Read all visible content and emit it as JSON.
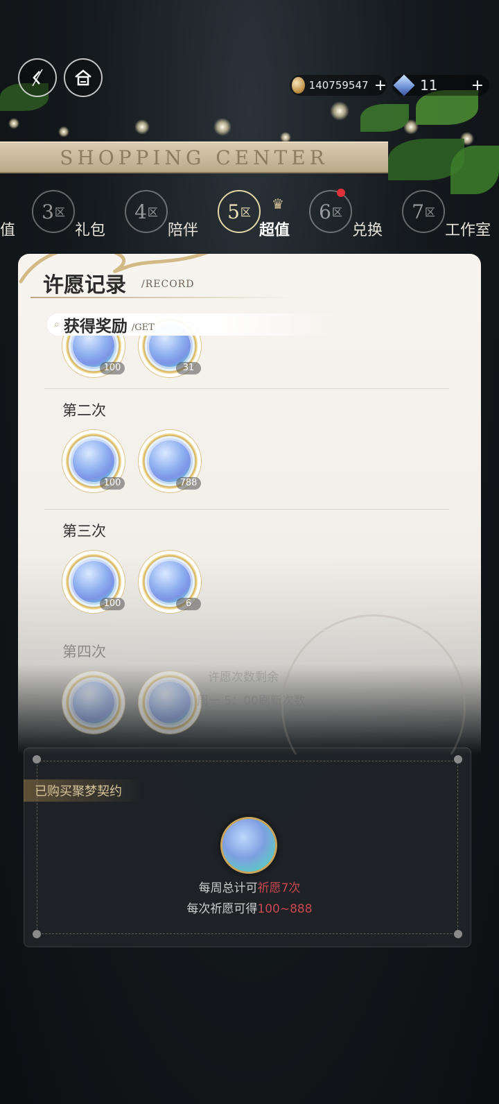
{
  "header": {
    "back_icon": "back-arrow-icon",
    "home_icon": "home-icon",
    "gold_amount": "140759547",
    "gold_plus": "+",
    "diamond_amount": "11",
    "diamond_plus": "+",
    "banner_text": "SHOPPING CENTER"
  },
  "zones": [
    {
      "num": "3",
      "suffix": "区",
      "label": "礼包"
    },
    {
      "num": "4",
      "suffix": "区",
      "label": "陪伴"
    },
    {
      "num": "5",
      "suffix": "区",
      "label": "超值"
    },
    {
      "num": "6",
      "suffix": "区",
      "label": "兑换"
    },
    {
      "num": "7",
      "suffix": "区",
      "label": "工作室"
    }
  ],
  "zone_prefix_label": "值",
  "record_panel": {
    "title": "许愿记录",
    "subtitle": "/RECORD",
    "get_title": "获得奖励",
    "get_subtitle": "/GET",
    "rounds": [
      {
        "label": "",
        "rewards": [
          {
            "qty": "100"
          },
          {
            "qty": "31"
          }
        ]
      },
      {
        "label": "第二次",
        "rewards": [
          {
            "qty": "100"
          },
          {
            "qty": "788"
          }
        ]
      },
      {
        "label": "第三次",
        "rewards": [
          {
            "qty": "100"
          },
          {
            "qty": "6"
          }
        ]
      },
      {
        "label": "第四次",
        "rewards": [
          {
            "qty": ""
          },
          {
            "qty": ""
          }
        ]
      }
    ],
    "faded_line1": "许愿次数剩余",
    "faded_line2": "周一 5：00刷新次数"
  },
  "contract": {
    "tag": "已购买聚梦契约",
    "line1_prefix": "每周总计可",
    "line1_highlight": "祈愿7次",
    "line2_prefix": "每次祈愿可得",
    "line2_highlight": "100~888"
  },
  "colors": {
    "accent_gold": "#d2ae58",
    "highlight_red": "#c8484f",
    "panel_bg": "#f7f4ef"
  }
}
